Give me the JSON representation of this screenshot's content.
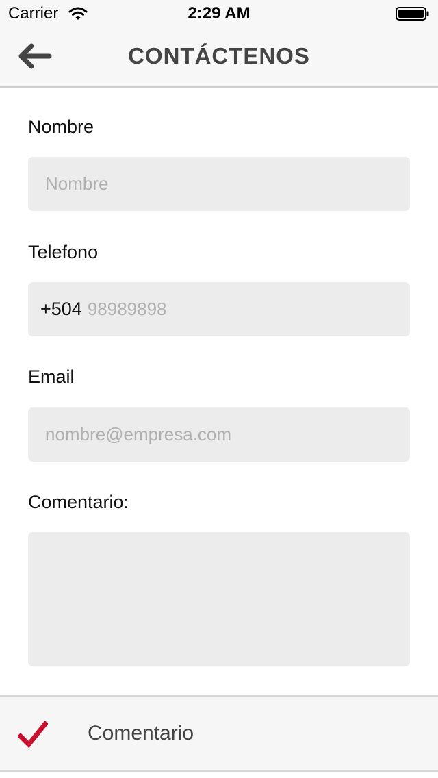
{
  "status_bar": {
    "carrier": "Carrier",
    "time": "2:29 AM",
    "wifi_icon": "wifi-icon",
    "battery_icon": "battery-icon"
  },
  "nav": {
    "title": "CONTÁCTENOS",
    "back_icon": "arrow-left-icon"
  },
  "form": {
    "name": {
      "label": "Nombre",
      "placeholder": "Nombre",
      "value": ""
    },
    "phone": {
      "label": "Telefono",
      "prefix": "+504",
      "placeholder": "98989898",
      "value": ""
    },
    "email": {
      "label": "Email",
      "placeholder": "nombre@empresa.com",
      "value": ""
    },
    "comment": {
      "label": "Comentario:",
      "value": ""
    }
  },
  "submit": {
    "label": "Comentario",
    "icon": "checkmark-icon"
  },
  "colors": {
    "accent_check": "#c8102e",
    "title_text": "#444444",
    "field_background": "#ececec",
    "placeholder_text": "#b0b0b0"
  }
}
